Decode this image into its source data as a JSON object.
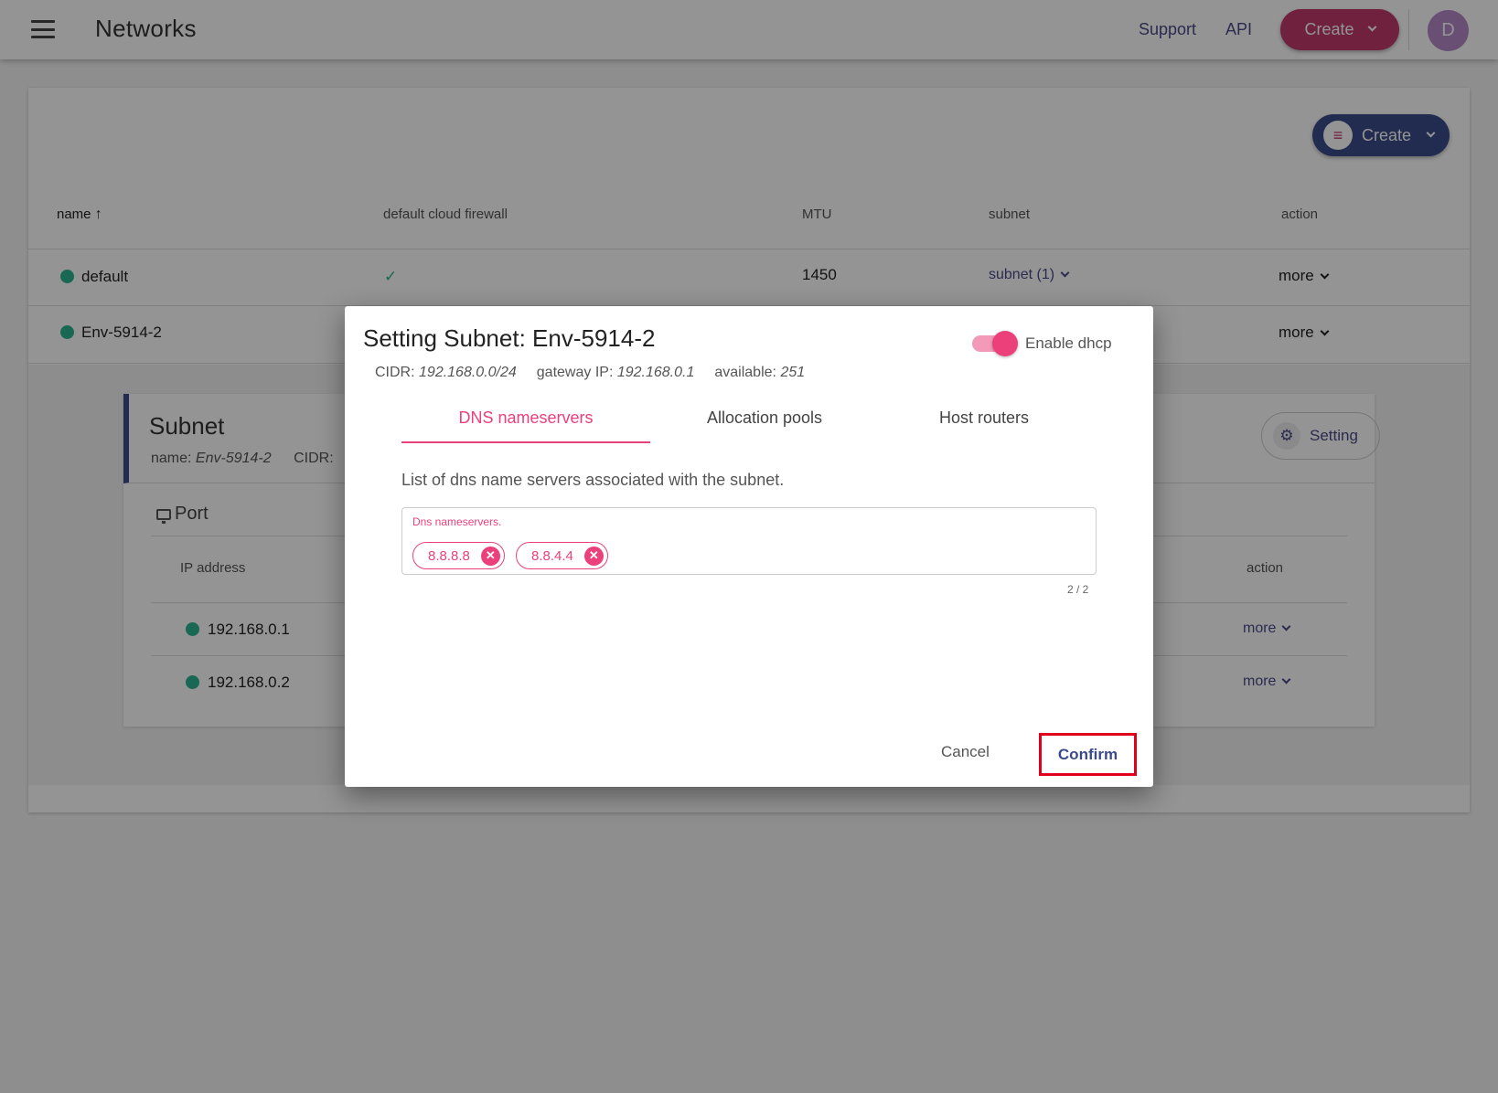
{
  "header": {
    "title": "Networks",
    "support_label": "Support",
    "api_label": "API",
    "create_label": "Create",
    "avatar_initial": "D"
  },
  "networks": {
    "create_label": "Create",
    "columns": {
      "name": "name",
      "firewall": "default cloud firewall",
      "mtu": "MTU",
      "subnet": "subnet",
      "action": "action"
    },
    "rows": [
      {
        "name": "default",
        "firewall": "✓",
        "mtu": "1450",
        "subnet": "subnet (1)",
        "action": "more"
      },
      {
        "name": "Env-5914-2",
        "action": "more"
      }
    ]
  },
  "subnet_panel": {
    "title": "Subnet",
    "name_label": "name:",
    "name_value": "Env-5914-2",
    "cidr_label": "CIDR:",
    "setting_label": "Setting",
    "port_title": "Port",
    "port_columns": {
      "ip": "IP address",
      "action": "action"
    },
    "ports": [
      {
        "ip": "192.168.0.1",
        "action": "more"
      },
      {
        "ip": "192.168.0.2",
        "action": "more"
      }
    ]
  },
  "dialog": {
    "title": "Setting Subnet: Env-5914-2",
    "dhcp_label": "Enable dhcp",
    "dhcp_enabled": true,
    "cidr_label": "CIDR:",
    "cidr_value": "192.168.0.0/24",
    "gateway_label": "gateway IP:",
    "gateway_value": "192.168.0.1",
    "available_label": "available:",
    "available_value": "251",
    "tabs": [
      "DNS nameservers",
      "Allocation pools",
      "Host routers"
    ],
    "active_tab": "DNS nameservers",
    "description": "List of dns name servers associated with the subnet.",
    "field_label": "Dns nameservers.",
    "chips": [
      "8.8.8.8",
      "8.8.4.4"
    ],
    "counter": "2 / 2",
    "cancel_label": "Cancel",
    "confirm_label": "Confirm"
  },
  "colors": {
    "accent": "#ec407a",
    "primary": "#3b4a8a",
    "status_green": "#2bb38f",
    "highlight": "#e0001b"
  }
}
